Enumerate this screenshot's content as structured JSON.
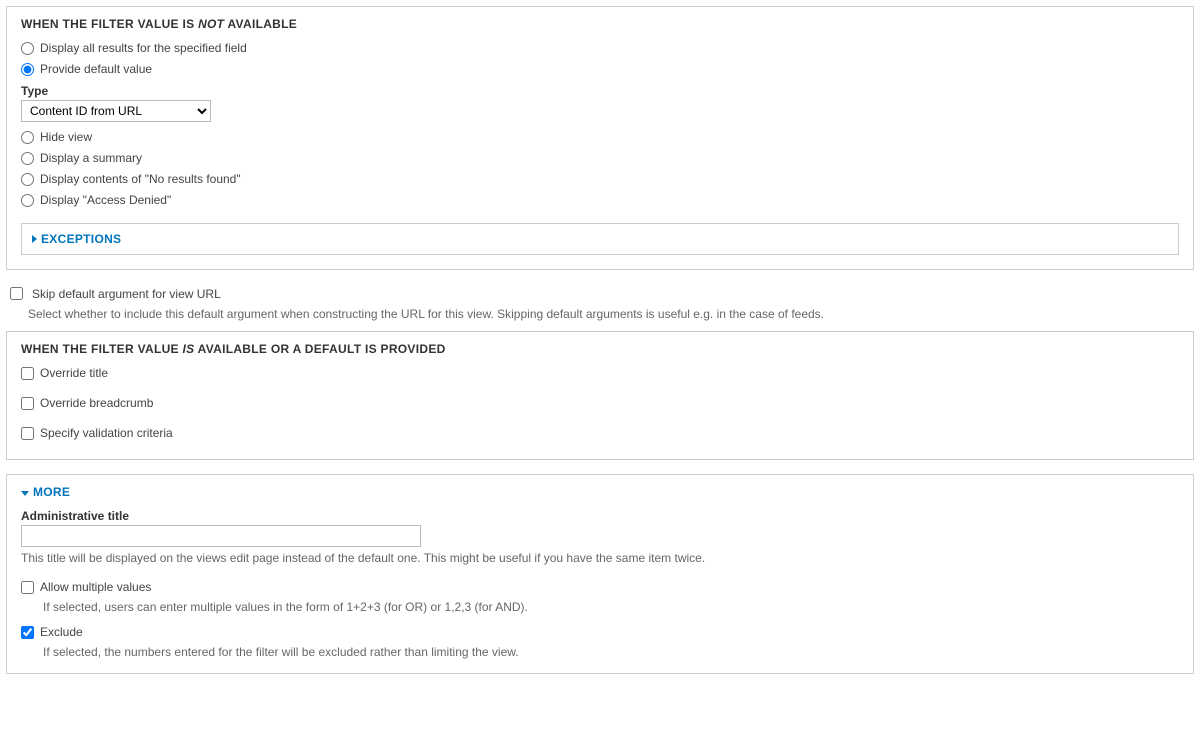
{
  "notAvailable": {
    "heading_prefix": "WHEN THE FILTER VALUE IS ",
    "heading_em": "NOT",
    "heading_suffix": " AVAILABLE",
    "radios": {
      "display_all": "Display all results for the specified field",
      "provide_default": "Provide default value",
      "hide_view": "Hide view",
      "display_summary": "Display a summary",
      "display_noresults": "Display contents of \"No results found\"",
      "display_access_denied": "Display \"Access Denied\""
    },
    "type_label": "Type",
    "type_value": "Content ID from URL",
    "exceptions_label": "EXCEPTIONS"
  },
  "skipDefault": {
    "label": "Skip default argument for view URL",
    "help": "Select whether to include this default argument when constructing the URL for this view. Skipping default arguments is useful e.g. in the case of feeds."
  },
  "isAvailable": {
    "heading_prefix": "WHEN THE FILTER VALUE ",
    "heading_em": "IS",
    "heading_suffix": " AVAILABLE OR A DEFAULT IS PROVIDED",
    "override_title": "Override title",
    "override_breadcrumb": "Override breadcrumb",
    "specify_validation": "Specify validation criteria"
  },
  "more": {
    "label": "MORE",
    "admin_title_label": "Administrative title",
    "admin_title_value": "",
    "admin_title_help": "This title will be displayed on the views edit page instead of the default one. This might be useful if you have the same item twice.",
    "allow_multiple_label": "Allow multiple values",
    "allow_multiple_help": "If selected, users can enter multiple values in the form of 1+2+3 (for OR) or 1,2,3 (for AND).",
    "exclude_label": "Exclude",
    "exclude_help": "If selected, the numbers entered for the filter will be excluded rather than limiting the view."
  }
}
